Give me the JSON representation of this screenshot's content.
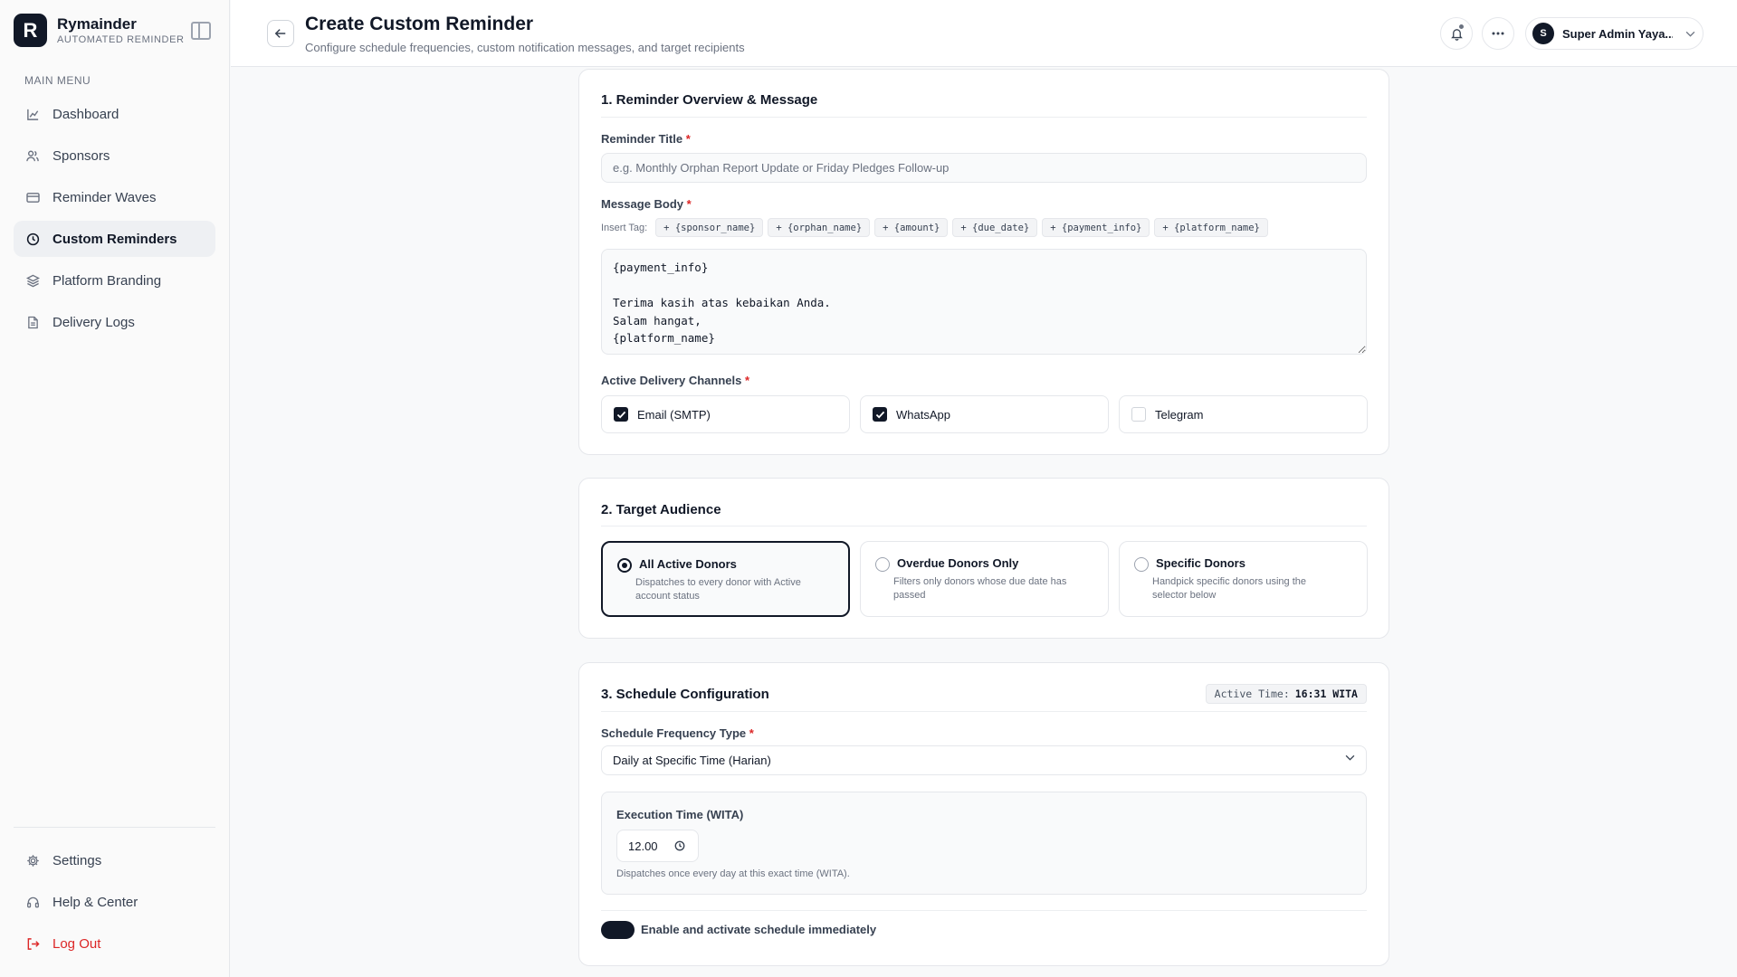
{
  "brand": {
    "logo_letter": "R",
    "name": "Rymainder",
    "subtitle": "AUTOMATED REMINDER"
  },
  "sidebar": {
    "section_label": "MAIN MENU",
    "items": [
      {
        "label": "Dashboard",
        "icon": "chart-line-icon"
      },
      {
        "label": "Sponsors",
        "icon": "users-icon"
      },
      {
        "label": "Reminder Waves",
        "icon": "credit-card-icon"
      },
      {
        "label": "Custom Reminders",
        "icon": "clock-icon",
        "active": true
      },
      {
        "label": "Platform Branding",
        "icon": "layers-icon"
      },
      {
        "label": "Delivery Logs",
        "icon": "file-text-icon"
      }
    ],
    "bottom_items": [
      {
        "label": "Settings",
        "icon": "gear-icon"
      },
      {
        "label": "Help & Center",
        "icon": "headset-icon"
      },
      {
        "label": "Log Out",
        "icon": "logout-icon"
      }
    ]
  },
  "header": {
    "title": "Create Custom Reminder",
    "subtitle": "Configure schedule frequencies, custom notification messages, and target recipients",
    "user": {
      "initial": "S",
      "name": "Super Admin Yaya..."
    }
  },
  "section1": {
    "title": "1. Reminder Overview & Message",
    "reminder_title_label": "Reminder Title",
    "reminder_title_placeholder": "e.g. Monthly Orphan Report Update or Friday Pledges Follow-up",
    "message_body_label": "Message Body",
    "insert_tag_label": "Insert Tag:",
    "tags": [
      "+ {sponsor_name}",
      "+ {orphan_name}",
      "+ {amount}",
      "+ {due_date}",
      "+ {payment_info}",
      "+ {platform_name}"
    ],
    "message_body": "{payment_info}\n\nTerima kasih atas kebaikan Anda.\nSalam hangat,\n{platform_name}",
    "channels_label": "Active Delivery Channels",
    "channels": [
      {
        "label": "Email (SMTP)",
        "checked": true
      },
      {
        "label": "WhatsApp",
        "checked": true
      },
      {
        "label": "Telegram",
        "checked": false
      }
    ]
  },
  "section2": {
    "title": "2. Target Audience",
    "options": [
      {
        "title": "All Active Donors",
        "desc": "Dispatches to every donor with Active account status",
        "selected": true
      },
      {
        "title": "Overdue Donors Only",
        "desc": "Filters only donors whose due date has passed",
        "selected": false
      },
      {
        "title": "Specific Donors",
        "desc": "Handpick specific donors using the selector below",
        "selected": false
      }
    ]
  },
  "section3": {
    "title": "3. Schedule Configuration",
    "active_time_label": "Active Time:",
    "active_time_value": "16:31 WITA",
    "frequency_label": "Schedule Frequency Type",
    "frequency_value": "Daily at Specific Time (Harian)",
    "execution_label": "Execution Time (WITA)",
    "execution_time": "12.00",
    "execution_hint": "Dispatches once every day at this exact time (WITA).",
    "toggle_label": "Enable and activate schedule immediately",
    "toggle_on": true
  },
  "colors": {
    "accent": "#111827",
    "danger": "#dc2626",
    "muted": "#6b7280",
    "border": "#e5e7eb"
  }
}
